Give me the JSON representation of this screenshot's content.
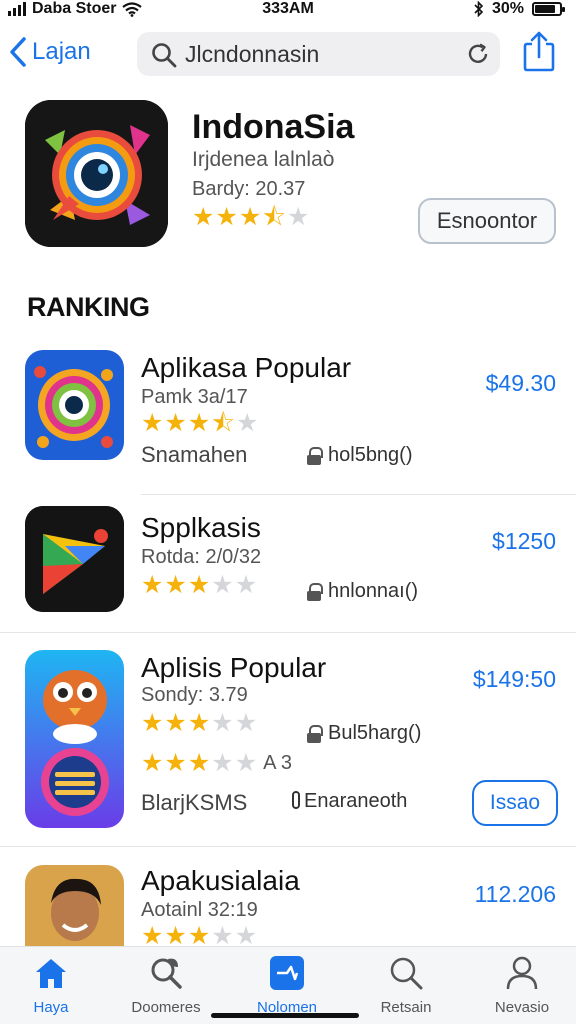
{
  "status": {
    "carrier": "Daba Stoer",
    "time": "333AM",
    "battery": "30%"
  },
  "nav": {
    "back_label": "Lajan",
    "search_value": "Jlcndonnasin"
  },
  "hero": {
    "title": "IndonaSia",
    "subtitle": "Irjdenea lalnlaò",
    "meta": "Bardy: 20.37",
    "rating": 3.5,
    "button_label": "Esnoontor"
  },
  "section_title": "RANKING",
  "apps": [
    {
      "name": "Aplikasa Popular",
      "sub": "Pamk 3a/17",
      "price": "$49.30",
      "rating": 3.5,
      "developer": "Snamahen",
      "lock_label": "hol5bng()"
    },
    {
      "name": "Spplkasis",
      "sub": "Rotda: 2/0/32",
      "price": "$1250",
      "rating": 3,
      "lock_label": "hnlonnaı()"
    },
    {
      "name": "Aplisis Popular",
      "sub": "Sondy: 3.79",
      "price": "$149:50",
      "rating": 3,
      "lock_label": "Bul5harg()",
      "rating2": 3,
      "rating2_label": "A 3",
      "developer": "BlarjKSMS",
      "lock_label2": "Enaraneoth",
      "button_label": "Issao"
    },
    {
      "name": "Apakusialaia",
      "sub": "Aotainl 32:19",
      "price": "112.206",
      "rating": 3
    }
  ],
  "tabs": [
    {
      "label": "Haya",
      "icon": "house-icon",
      "active": true
    },
    {
      "label": "Doomeres",
      "icon": "magnifier-leaf-icon",
      "active": false
    },
    {
      "label": "Nolomen",
      "icon": "heart-square-icon",
      "active": false
    },
    {
      "label": "Retsain",
      "icon": "search-icon",
      "active": false
    },
    {
      "label": "Nevasio",
      "icon": "person-icon",
      "active": false
    }
  ],
  "colors": {
    "accent": "#1a73e8",
    "star": "#f5b20a",
    "star_off": "#d4d6da"
  }
}
